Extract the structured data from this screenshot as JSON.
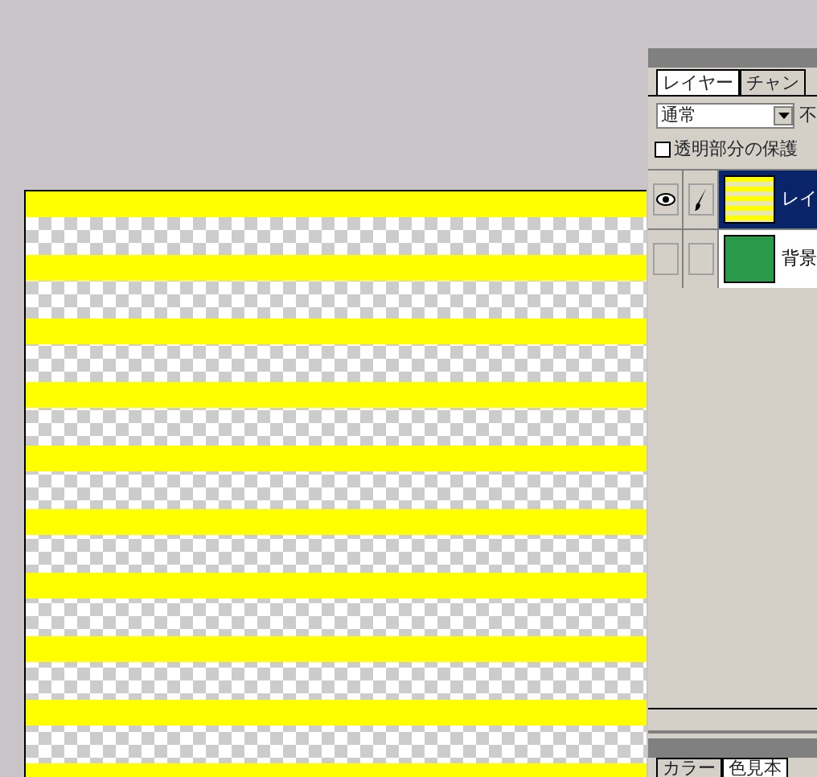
{
  "layers_panel": {
    "tabs": [
      {
        "label": "レイヤー",
        "selected": true
      },
      {
        "label": "チャン",
        "selected": false
      }
    ],
    "blend_mode": "通常",
    "opacity_label": "不",
    "lock_transparency": {
      "label": "透明部分の保護",
      "checked": false
    },
    "layers": [
      {
        "name": "レイ",
        "visible": true,
        "editing": true,
        "selected": true,
        "kind": "pattern"
      },
      {
        "name": "背景",
        "visible": false,
        "editing": false,
        "selected": false,
        "kind": "solid",
        "color": "#2a9a4a"
      }
    ]
  },
  "color_panel": {
    "tabs": [
      {
        "label": "カラー",
        "selected": false
      },
      {
        "label": "色見本",
        "selected": true
      }
    ]
  }
}
